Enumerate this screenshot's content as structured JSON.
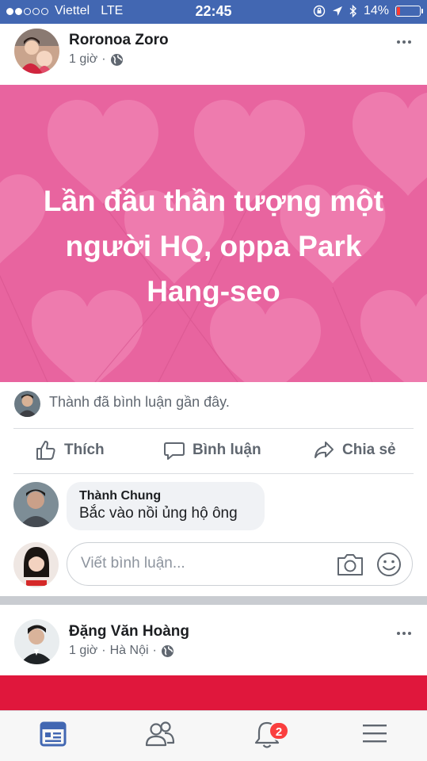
{
  "status_bar": {
    "carrier": "Viettel",
    "network": "LTE",
    "time": "22:45",
    "battery": "14%",
    "battery_level": 0.14,
    "signal_bars_filled": 2,
    "signal_bars_total": 5
  },
  "post1": {
    "author": "Roronoa Zoro",
    "time": "1 giờ",
    "separator": "·",
    "privacy_icon": "globe-icon",
    "banner_text": "Lần đầu thần tượng một người HQ, oppa Park Hang-seo",
    "banner_color": "#e8649f",
    "recent_comment_note": "Thành đã bình luận gần đây."
  },
  "actions": {
    "like": "Thích",
    "comment": "Bình luận",
    "share": "Chia sẻ"
  },
  "comment": {
    "author": "Thành Chung",
    "text": "Bắc vào nồi ủng hộ ông"
  },
  "composer": {
    "placeholder": "Viết bình luận...",
    "camera_icon": "camera-icon",
    "emoji_icon": "smiley-icon"
  },
  "post2": {
    "author": "Đặng Văn Hoàng",
    "time": "1 giờ",
    "separator": "·",
    "location": "Hà Nội",
    "separator2": "·",
    "privacy_icon": "globe-icon",
    "banner_color": "#e0173c"
  },
  "tab_bar": {
    "tabs": [
      "news-feed-icon",
      "friends-icon",
      "notifications-icon",
      "menu-icon"
    ],
    "notification_count": "2",
    "accent": "#4267b2"
  }
}
